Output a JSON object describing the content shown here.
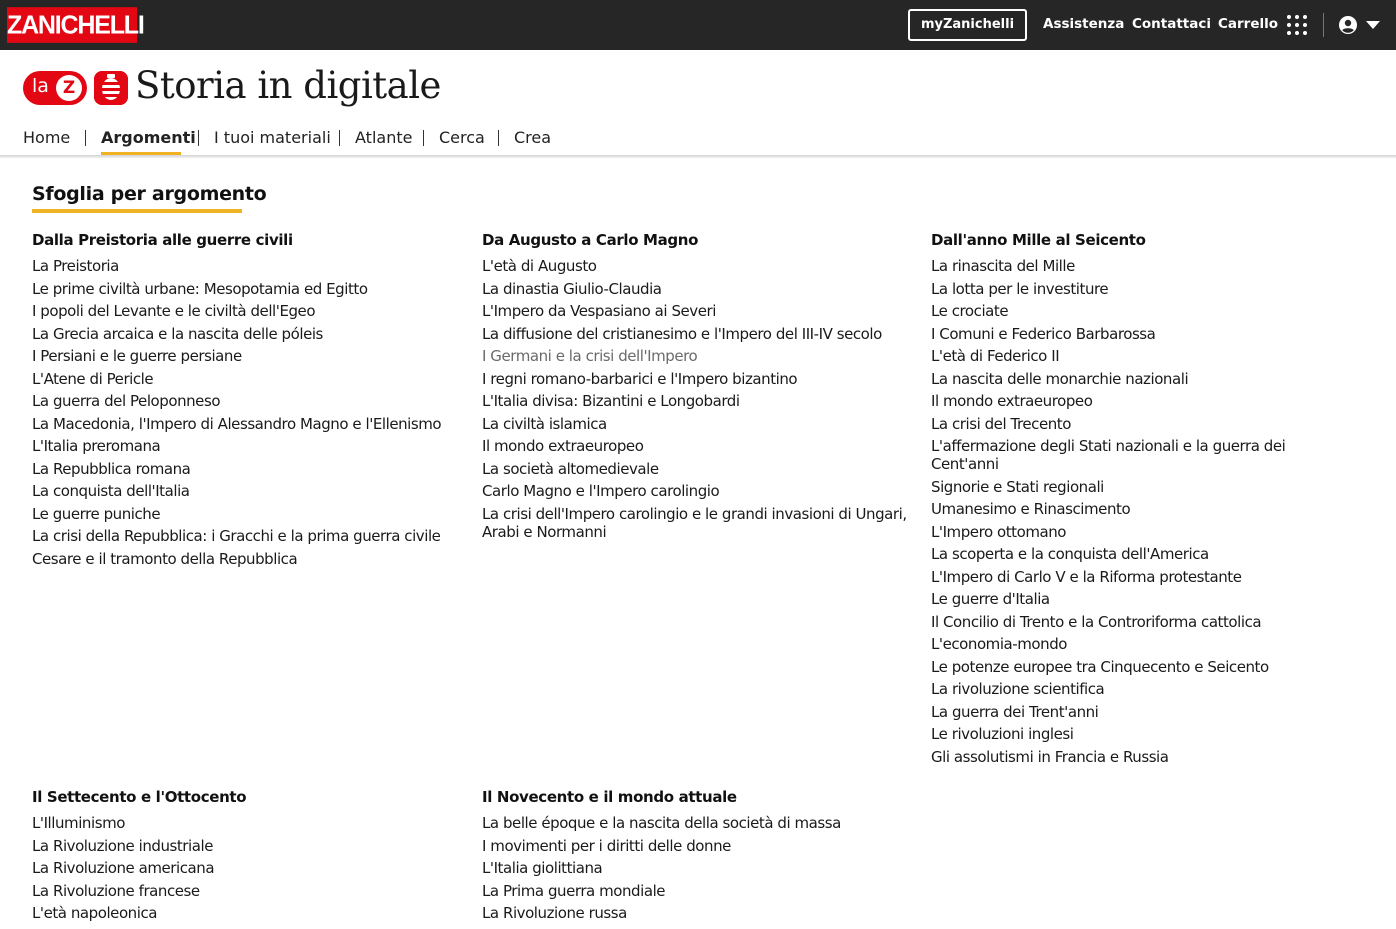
{
  "topbar": {
    "logo": "ZANICHELLI",
    "my_button": "myZanichelli",
    "links": [
      "Assistenza",
      "Contattaci",
      "Carrello"
    ],
    "icons": [
      "apps-grid-icon",
      "user-icon",
      "chevron-down-icon"
    ]
  },
  "brand": {
    "badge_la": "la",
    "badge_z": "Z",
    "title": "Storia in digitale"
  },
  "nav": {
    "items": [
      "Home",
      "Argomenti",
      "I tuoi materiali",
      "Atlante",
      "Cerca",
      "Crea"
    ],
    "active": "Argomenti"
  },
  "colors": {
    "brand_red": "#e30613",
    "accent_yellow": "#f0b323",
    "topbar_bg": "#262626"
  },
  "content": {
    "title": "Sfoglia per argomento",
    "groups": [
      {
        "heading": "Dalla Preistoria alle guerre civili",
        "items": [
          "La Preistoria",
          "Le prime civiltà urbane: Mesopotamia ed Egitto",
          "I popoli del Levante e le civiltà dell'Egeo",
          "La Grecia arcaica e la nascita delle póleis",
          "I Persiani e le guerre persiane",
          "L'Atene di Pericle",
          "La guerra del Peloponneso",
          "La Macedonia, l'Impero di Alessandro Magno e l'Ellenismo",
          "L'Italia preromana",
          "La Repubblica romana",
          "La conquista dell'Italia",
          "Le guerre puniche",
          "La crisi della Repubblica: i Gracchi e la prima guerra civile",
          "Cesare e il tramonto della Repubblica"
        ]
      },
      {
        "heading": "Da Augusto a Carlo Magno",
        "items": [
          "L'età di Augusto",
          "La dinastia Giulio-Claudia",
          "L'Impero da Vespasiano ai Severi",
          "La diffusione del cristianesimo e l'Impero del III-IV secolo",
          "I Germani e la crisi dell'Impero",
          "I regni romano-barbarici e l'Impero bizantino",
          "L'Italia divisa: Bizantini e Longobardi",
          "La civiltà islamica",
          "Il mondo extraeuropeo",
          "La società altomedievale",
          "Carlo Magno e l'Impero carolingio",
          "La crisi dell'Impero carolingio e le grandi invasioni di Ungari, Arabi e Normanni"
        ]
      },
      {
        "heading": "Dall'anno Mille al Seicento",
        "items": [
          "La rinascita del Mille",
          "La lotta per le investiture",
          "Le crociate",
          "I Comuni e Federico Barbarossa",
          "L'età di Federico II",
          "La nascita delle monarchie nazionali",
          "Il mondo extraeuropeo",
          "La crisi del Trecento",
          "L'affermazione degli Stati nazionali e la guerra dei Cent'anni",
          "Signorie e Stati regionali",
          "Umanesimo e Rinascimento",
          "L'Impero ottomano",
          "La scoperta e la conquista dell'America",
          "L'Impero di Carlo V e la Riforma protestante",
          "Le guerre d'Italia",
          "Il Concilio di Trento e la Controriforma cattolica",
          "L'economia-mondo",
          "Le potenze europee tra Cinquecento e Seicento",
          "La rivoluzione scientifica",
          "La guerra dei Trent'anni",
          "Le rivoluzioni inglesi",
          "Gli assolutismi in Francia e Russia"
        ]
      },
      {
        "heading": "Il Settecento e l'Ottocento",
        "items": [
          "L'Illuminismo",
          "La Rivoluzione industriale",
          "La Rivoluzione americana",
          "La Rivoluzione francese",
          "L'età napoleonica"
        ]
      },
      {
        "heading": "Il Novecento e il mondo attuale",
        "items": [
          "La belle époque e la nascita della società di massa",
          "I movimenti per i diritti delle donne",
          "L'Italia giolittiana",
          "La Prima guerra mondiale",
          "La Rivoluzione russa"
        ]
      }
    ]
  }
}
